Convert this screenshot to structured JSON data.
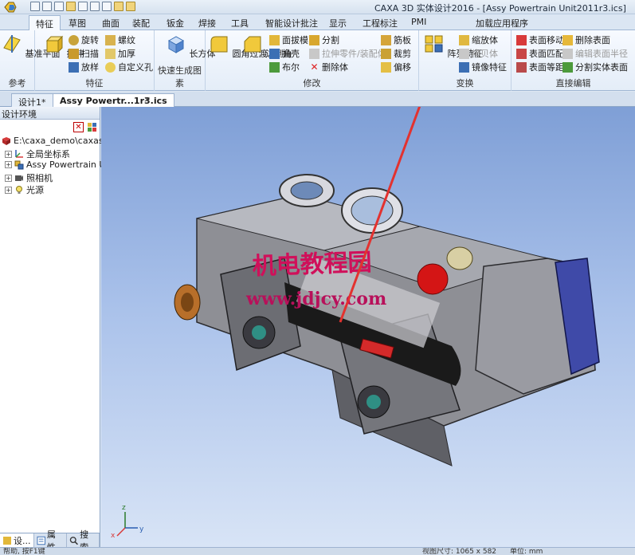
{
  "window": {
    "title": "CAXA 3D 实体设计2016 - [Assy Powertrain Unit2011r3.ics]"
  },
  "ribbon_tabs": [
    "特征",
    "草图",
    "曲面",
    "装配",
    "钣金",
    "焊接",
    "工具",
    "智能设计批注",
    "显示",
    "工程标注",
    "PMI",
    "加载应用程序"
  ],
  "ribbon": {
    "groups": {
      "ref": "参考",
      "feature": "特征",
      "quick": "快速生成图素",
      "modify": "修改",
      "transform": "变换",
      "direct": "直接编辑"
    },
    "buttons": {
      "base_plane": "基准平面",
      "extrude": "拉伸",
      "revolve": "旋转",
      "sweep": "扫描",
      "loft": "放样",
      "thread": "螺纹",
      "thicken": "加厚",
      "custom_hole": "自定义孔",
      "box": "长方体",
      "fillet": "圆角过渡",
      "chamfer": "边倒角",
      "draft": "面拔模",
      "shell": "抽壳",
      "boolean": "布尔",
      "split": "分割",
      "extrude_part": "拉伸零件/装配体",
      "delete_body": "删除体",
      "rib": "筋板",
      "trim": "裁剪",
      "offset": "偏移",
      "pattern": "阵列特征",
      "scale": "缩放体",
      "copy_body": "拷贝体",
      "mirror": "镜像特征",
      "face_move": "表面移动",
      "face_match": "表面匹配",
      "face_equal": "表面等距",
      "delete_face": "删除表面",
      "edit_face_radius": "编辑表面半径",
      "split_face": "分割实体表面"
    }
  },
  "doc_tabs": [
    "设计1*",
    "Assy Powertr...1r3.ics"
  ],
  "doc_tab_close": "×",
  "left_panel": {
    "title": "设计环境",
    "tree": [
      {
        "label": "E:\\caxa_demo\\caxasoli"
      },
      {
        "label": "全局坐标系"
      },
      {
        "label": "Assy Powertrain Uni"
      },
      {
        "label": "照相机"
      },
      {
        "label": "光源"
      }
    ],
    "footer_tabs": [
      "设...",
      "属性",
      "搜索"
    ]
  },
  "viewport": {
    "watermark_cn": "机电教程园",
    "watermark_url": "www.jdjcy.com",
    "axes": {
      "x": "x",
      "y": "y",
      "z": "z"
    }
  },
  "status": {
    "left": "帮助, 按F1键",
    "mid": "视图尺寸: 1065 x 582",
    "right": "单位: mm"
  },
  "colors": {
    "accent": "#3c6fb4",
    "annotation_arrow": "#e3322f"
  }
}
